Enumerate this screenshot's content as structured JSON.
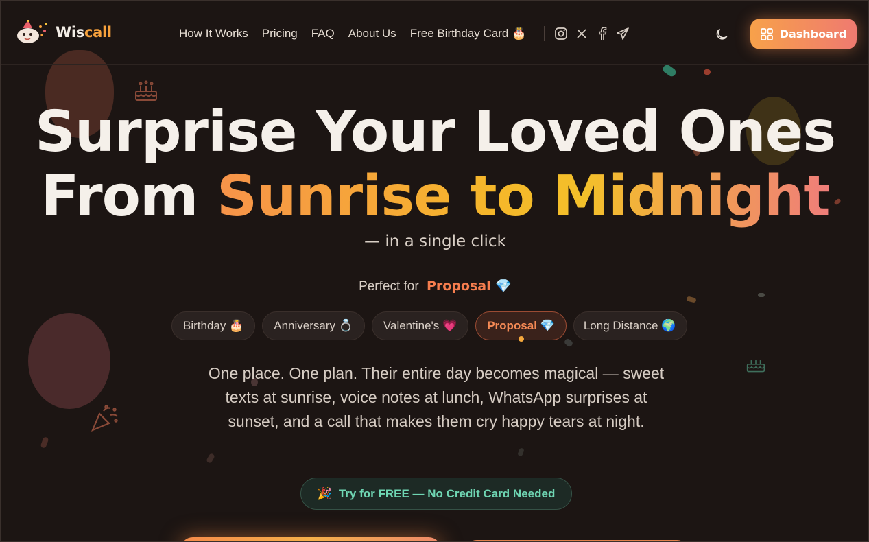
{
  "brand": {
    "name_part1": "Wis",
    "name_part2": "call"
  },
  "nav": {
    "links": [
      "How It Works",
      "Pricing",
      "FAQ",
      "About Us",
      "Free Birthday Card 🎂"
    ]
  },
  "header": {
    "dashboard_label": "Dashboard"
  },
  "hero": {
    "title_line1": "Surprise Your Loved Ones",
    "title_line2_plain": "From ",
    "title_line2_gradient": "Sunrise to Midnight",
    "tagline": "— in a single click",
    "perfect_prefix": "Perfect for",
    "perfect_occasion": "Proposal 💎",
    "occasions": [
      "Birthday 🎂",
      "Anniversary 💍",
      "Valentine's 💗",
      "Proposal 💎",
      "Long Distance 🌍"
    ],
    "active_occasion": "Proposal 💎",
    "description": "One place. One plan. Their entire day becomes magical — sweet texts at sunrise, voice notes at lunch, WhatsApp surprises at sunset, and a call that makes them cry happy tears at night.",
    "try_free_label": "Try for FREE — No Credit Card Needed",
    "try_free_emoji": "🎉"
  },
  "colors": {
    "background": "#1c1513",
    "accent_orange": "#f7a13c",
    "active_chip": "#f58a55",
    "try_free": "#6fd6b3"
  }
}
